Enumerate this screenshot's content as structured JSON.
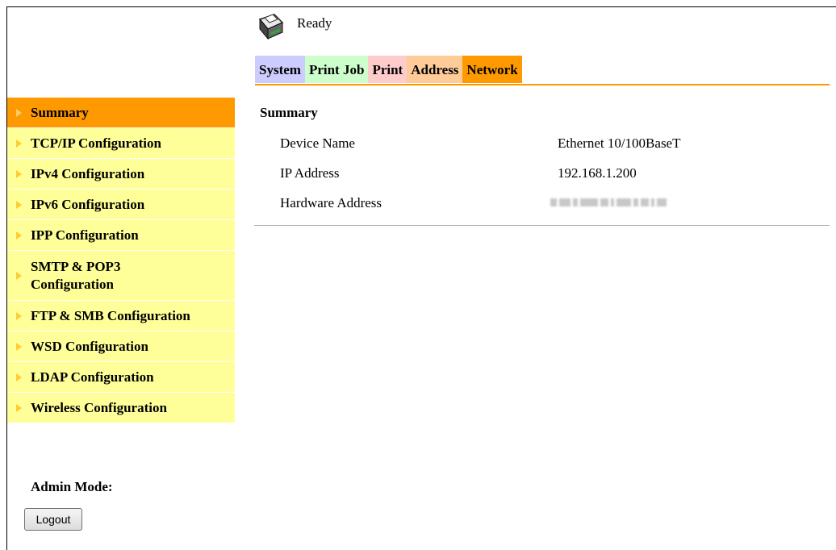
{
  "status": {
    "text": "Ready",
    "icon": "printer-icon"
  },
  "tabs": [
    {
      "label": "System",
      "color": "#ccccff"
    },
    {
      "label": "Print Job",
      "color": "#ccffcc"
    },
    {
      "label": "Print",
      "color": "#ffcccc"
    },
    {
      "label": "Address",
      "color": "#ffcc99"
    },
    {
      "label": "Network",
      "color": "#ff9900",
      "active": true
    }
  ],
  "sidebar": {
    "items": [
      {
        "label": "Summary",
        "active": true
      },
      {
        "label": "TCP/IP Configuration"
      },
      {
        "label": "IPv4 Configuration"
      },
      {
        "label": "IPv6 Configuration"
      },
      {
        "label": "IPP Configuration"
      },
      {
        "label": "SMTP & POP3 Configuration"
      },
      {
        "label": "FTP & SMB Configuration"
      },
      {
        "label": "WSD Configuration"
      },
      {
        "label": "LDAP Configuration"
      },
      {
        "label": "Wireless Configuration"
      }
    ]
  },
  "admin": {
    "label": "Admin Mode:",
    "logout_label": "Logout"
  },
  "summary": {
    "title": "Summary",
    "rows": [
      {
        "label": "Device Name",
        "value": "Ethernet 10/100BaseT"
      },
      {
        "label": "IP Address",
        "value": "192.168.1.200"
      },
      {
        "label": "Hardware Address",
        "value": ""
      }
    ]
  },
  "colors": {
    "accent": "#ff9900",
    "sidebar_bg": "#ffff99"
  }
}
